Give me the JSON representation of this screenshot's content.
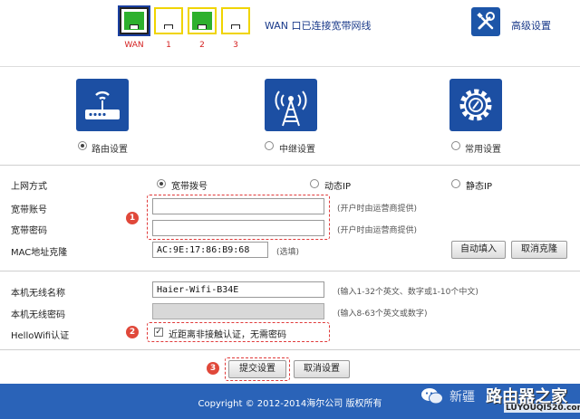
{
  "header": {
    "ports": [
      {
        "label": "WAN",
        "state": "connected",
        "color": "#2db02d"
      },
      {
        "label": "1",
        "state": "empty",
        "color": "#f0d400"
      },
      {
        "label": "2",
        "state": "connected",
        "color": "#2db02d"
      },
      {
        "label": "3",
        "state": "empty",
        "color": "#f0d400"
      }
    ],
    "wan_status": "WAN 口已连接宽带网线",
    "advanced_label": "高级设置",
    "advanced_icon": "wrench-screwdriver-icon"
  },
  "modes": [
    {
      "label": "路由设置",
      "icon": "router-icon",
      "selected": true
    },
    {
      "label": "中继设置",
      "icon": "tower-icon",
      "selected": false
    },
    {
      "label": "常用设置",
      "icon": "gear-icon",
      "selected": false
    }
  ],
  "form": {
    "connection_type_label": "上网方式",
    "connection_options": [
      {
        "label": "宽带拨号",
        "selected": true
      },
      {
        "label": "动态IP",
        "selected": false
      },
      {
        "label": "静态IP",
        "selected": false
      }
    ],
    "account_label": "宽带账号",
    "account_value": "",
    "account_hint": "(开户时由运营商提供)",
    "password_label": "宽带密码",
    "password_value": "",
    "password_hint": "(开户时由运营商提供)",
    "mac_label": "MAC地址克隆",
    "mac_value": "AC:9E:17:86:B9:68",
    "mac_hint": "(选填)",
    "autofill_button": "自动填入",
    "cancel_clone_button": "取消克隆",
    "ssid_label": "本机无线名称",
    "ssid_value": "Haier-Wifi-B34E",
    "ssid_hint": "(输入1-32个英文、数字或1-10个中文)",
    "wifi_password_label": "本机无线密码",
    "wifi_password_value": "",
    "wifi_password_hint": "(输入8-63个英文或数字)",
    "hellowifi_label": "HelloWifi认证",
    "hellowifi_checked": true,
    "hellowifi_text": "近距离非接触认证，无需密码",
    "submit_button": "提交设置",
    "cancel_button": "取消设置"
  },
  "annotations": {
    "step1": "1",
    "step2": "2",
    "step3": "3",
    "color": "#e0483a"
  },
  "footer": {
    "copyright": "Copyright © 2012-2014海尔公司 版权所有",
    "color": "#2a63b8"
  },
  "watermark": {
    "prefix": "新疆",
    "brand": "路由器之家",
    "url": "LUYOUQI520.com"
  },
  "colors": {
    "accent_blue": "#1c4fa3",
    "title_blue": "#1a3a8a"
  }
}
